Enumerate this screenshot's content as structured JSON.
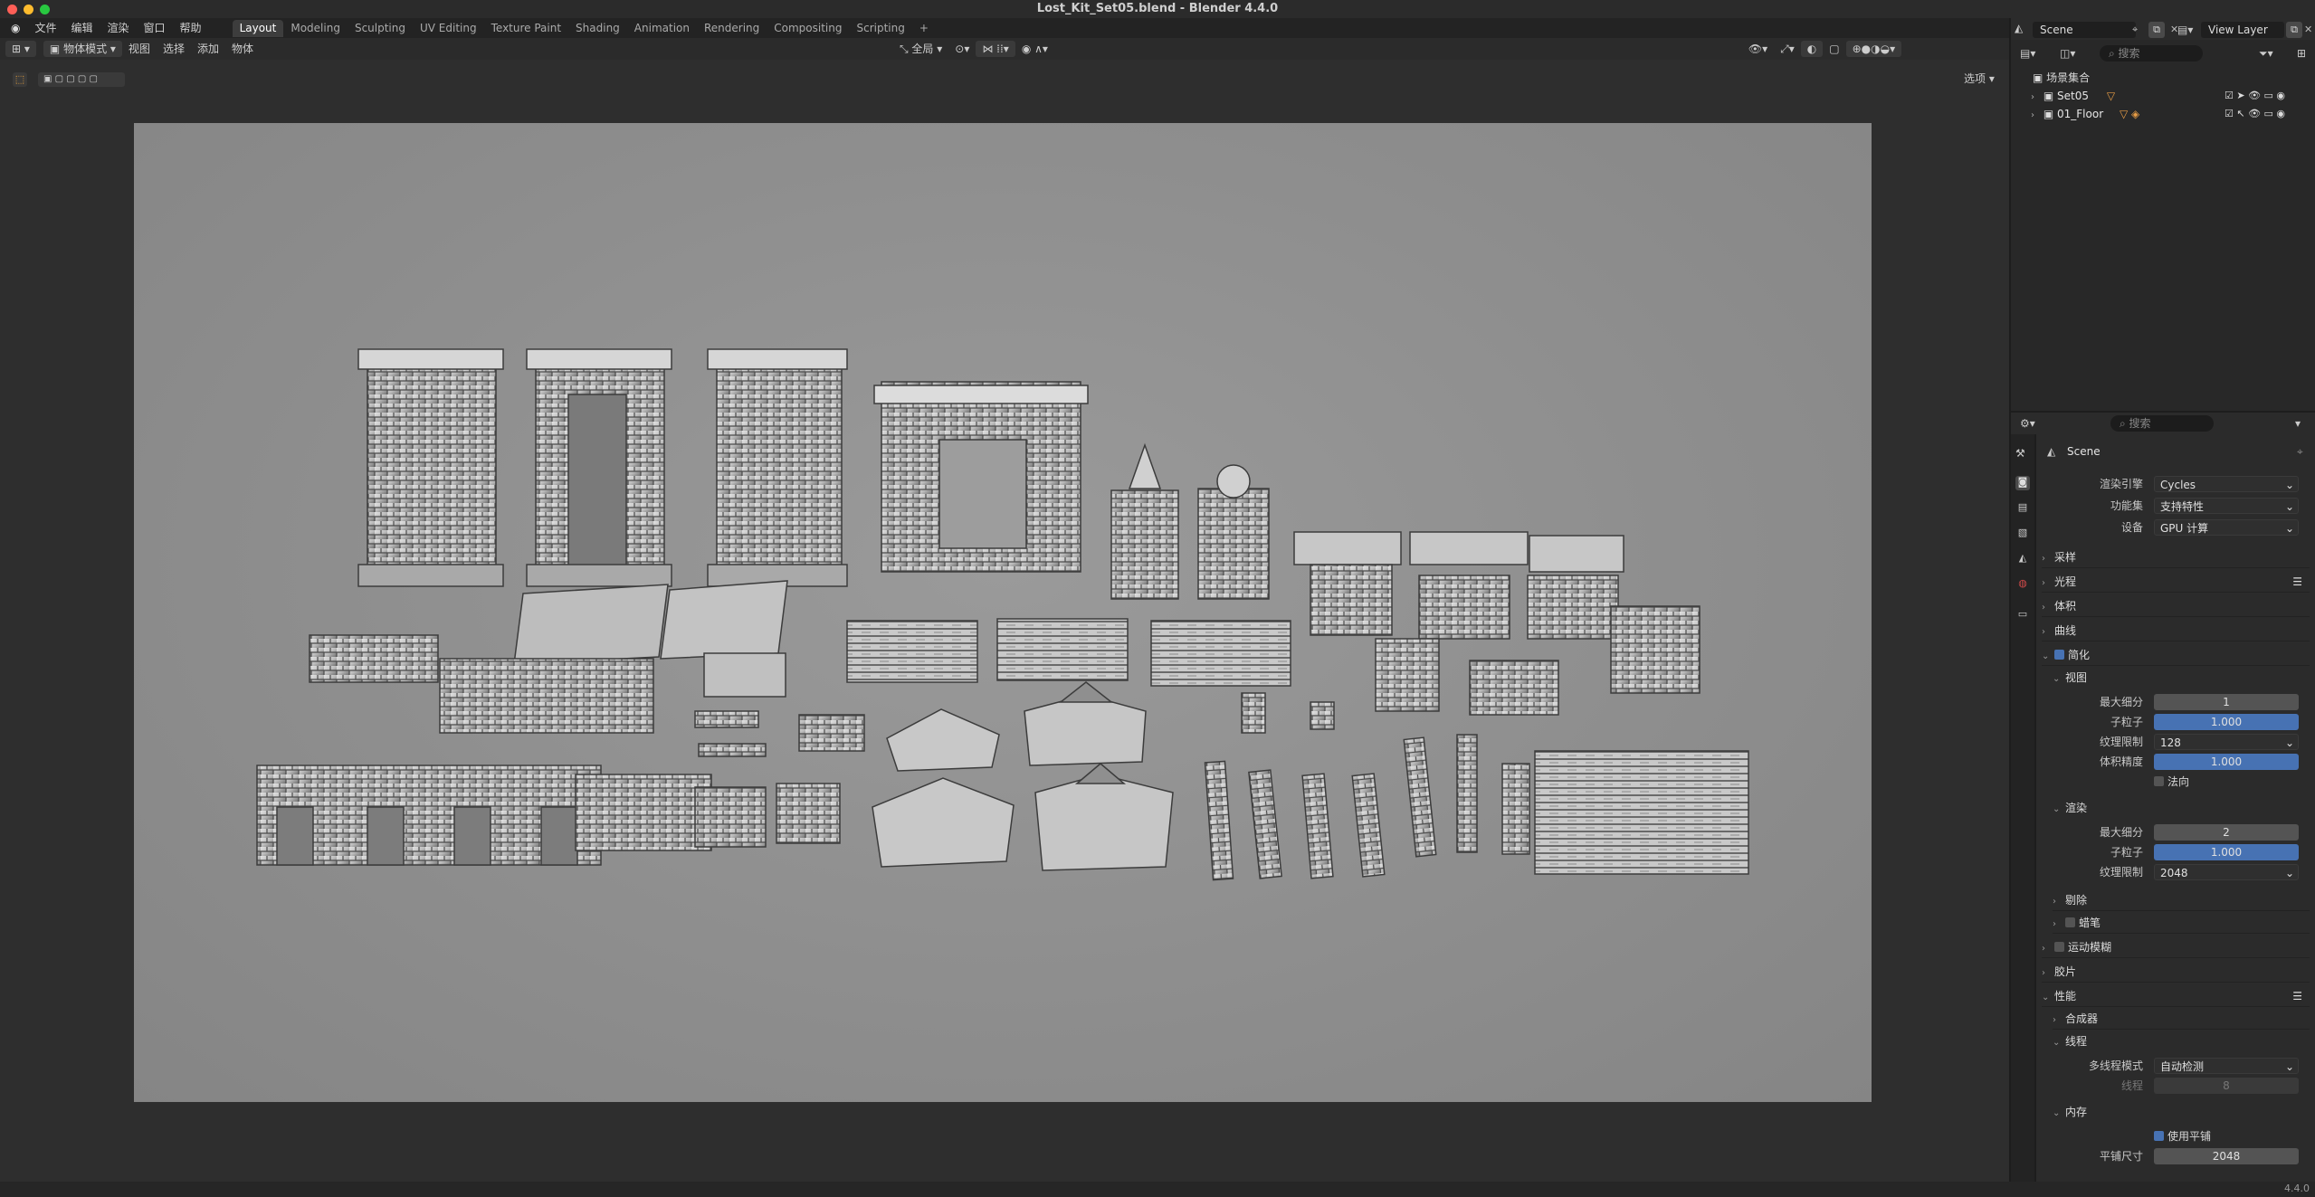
{
  "window": {
    "title": "Lost_Kit_Set05.blend - Blender 4.4.0",
    "traffic_colors": [
      "#ff5f57",
      "#febc2e",
      "#28c840"
    ]
  },
  "menus": [
    "文件",
    "编辑",
    "渲染",
    "窗口",
    "帮助"
  ],
  "workspaces": [
    "Layout",
    "Modeling",
    "Sculpting",
    "UV Editing",
    "Texture Paint",
    "Shading",
    "Animation",
    "Rendering",
    "Compositing",
    "Scripting",
    "+"
  ],
  "viewport_header": {
    "mode": "物体模式",
    "menus": [
      "视图",
      "选择",
      "添加",
      "物体"
    ],
    "orientation": "全局",
    "options": "选项"
  },
  "scene_selector": "Scene",
  "view_layer": "View Layer",
  "outliner": {
    "search_placeholder": "搜索",
    "root": "场景集合",
    "items": [
      {
        "name": "Set05"
      },
      {
        "name": "01_Floor"
      }
    ]
  },
  "properties": {
    "search_placeholder": "搜索",
    "context": "Scene",
    "render_engine_label": "渲染引擎",
    "render_engine": "Cycles",
    "feature_set_label": "功能集",
    "feature_set": "支持特性",
    "device_label": "设备",
    "device": "GPU 计算",
    "sections": {
      "sampling": "采样",
      "light_paths": "光程",
      "volumes": "体积",
      "curves": "曲线",
      "simplify": "简化",
      "viewport": "视图",
      "render": "渲染",
      "culling": "剔除",
      "grease_pencil": "蜡笔",
      "motion_blur": "运动模糊",
      "film": "胶片",
      "performance": "性能",
      "compositor": "合成器",
      "threads": "线程",
      "memory": "内存"
    },
    "viewport_simplify": {
      "max_subdiv_label": "最大细分",
      "max_subdiv": "1",
      "child_particles_label": "子粒子",
      "child_particles": "1.000",
      "texture_limit_label": "纹理限制",
      "texture_limit": "128",
      "volume_resolution_label": "体积精度",
      "volume_resolution": "1.000",
      "normals_label": "法向"
    },
    "render_simplify": {
      "max_subdiv_label": "最大细分",
      "max_subdiv": "2",
      "child_particles_label": "子粒子",
      "child_particles": "1.000",
      "texture_limit_label": "纹理限制",
      "texture_limit": "2048"
    },
    "threads": {
      "mode_label": "多线程模式",
      "mode": "自动检测",
      "count_label": "线程",
      "count": "8"
    },
    "memory": {
      "use_tiling_label": "使用平铺",
      "tile_size_label": "平铺尺寸",
      "tile_size": "2048"
    }
  },
  "status": {
    "version": "4.4.0"
  }
}
